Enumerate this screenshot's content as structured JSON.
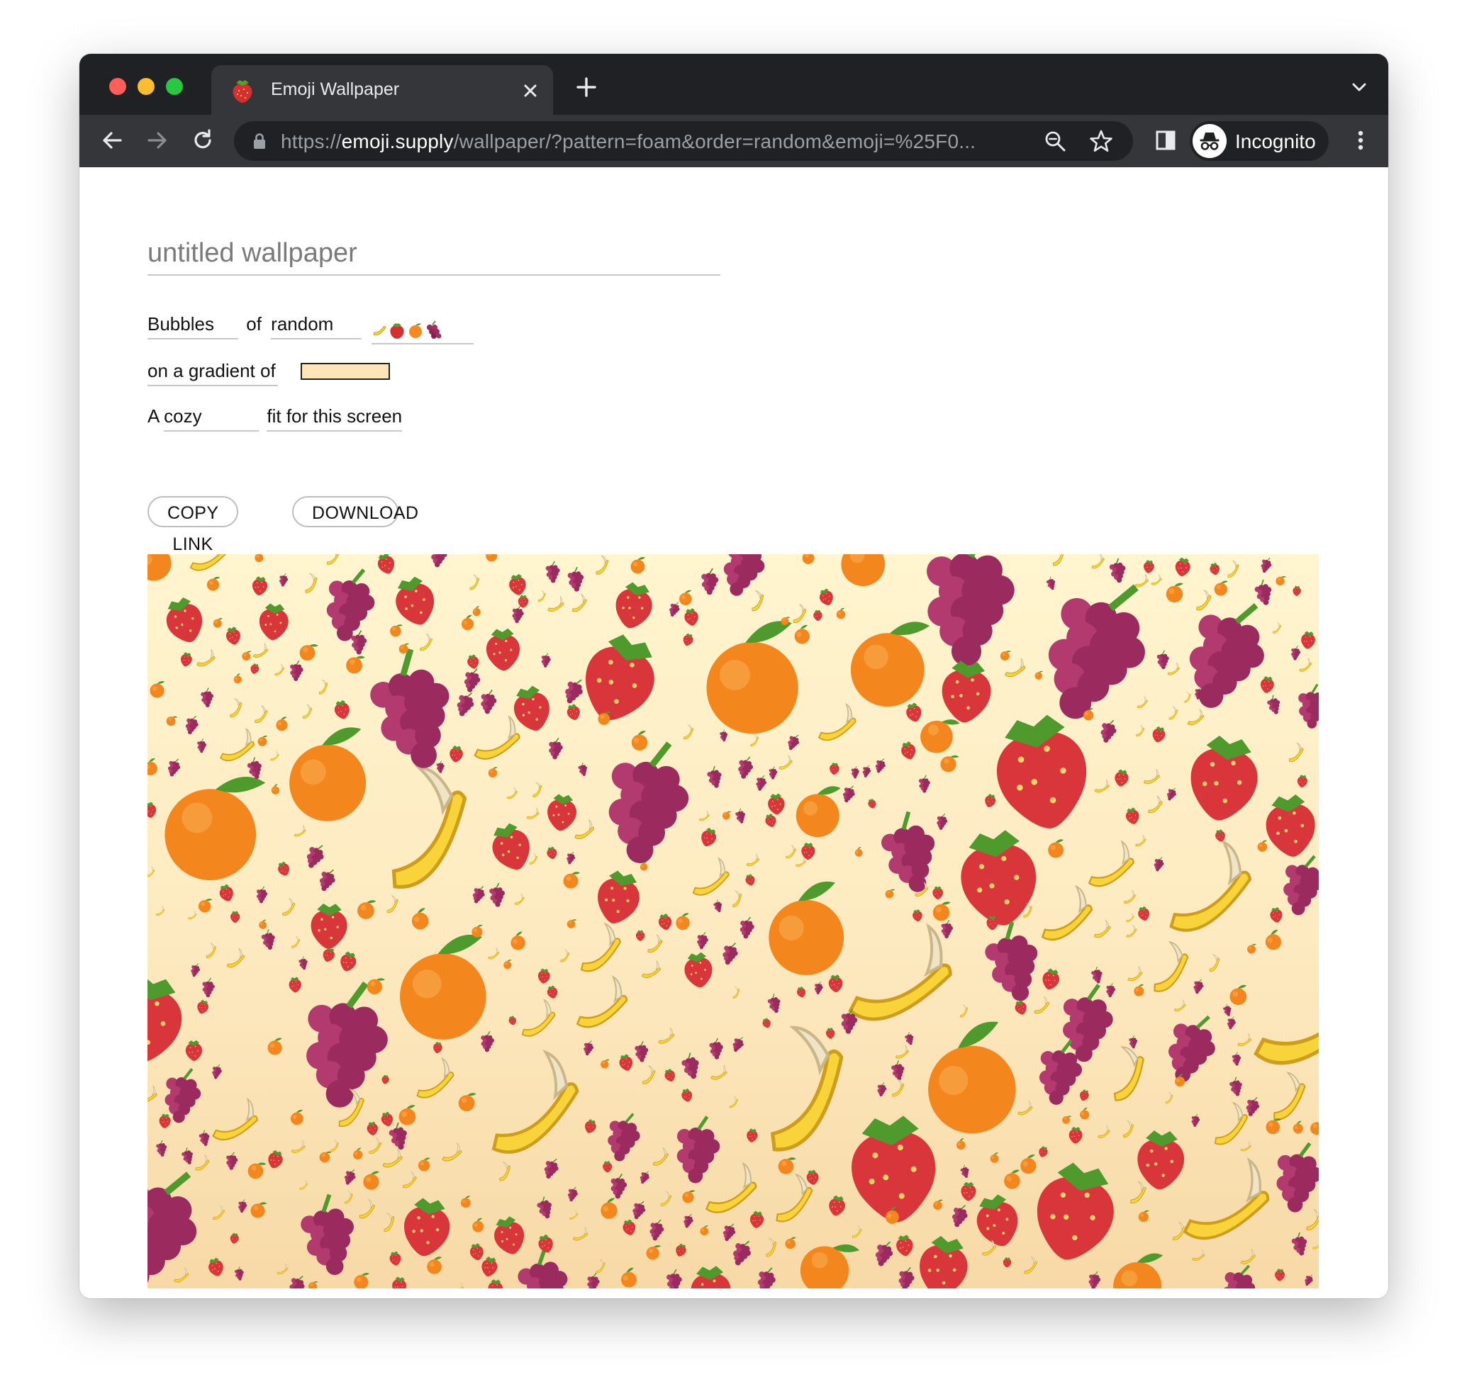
{
  "browser": {
    "tab": {
      "title": "Emoji Wallpaper",
      "favicon": "strawberry-icon"
    },
    "url": {
      "scheme": "https://",
      "host": "emoji.supply",
      "path": "/wallpaper/?pattern=foam&order=random&emoji=%25F0..."
    },
    "profile_label": "Incognito"
  },
  "editor": {
    "title_placeholder": "untitled wallpaper",
    "pattern": "Bubbles",
    "of_word": "of",
    "order": "random",
    "emoji": [
      "banana",
      "strawberry",
      "orange",
      "grapes"
    ],
    "gradient_label": "on a gradient of",
    "gradient_color": "#ffe5b8",
    "fit_prefix": "A",
    "fit_size": "cozy",
    "fit_suffix": "fit for this screen"
  },
  "actions": {
    "copy_label": "COPY LINK",
    "download_label": "DOWNLOAD"
  },
  "preview": {
    "background_top": "#fff5cf",
    "background_bottom": "#f7d9a6",
    "fruits": [
      "strawberry",
      "orange",
      "grapes",
      "banana"
    ]
  }
}
